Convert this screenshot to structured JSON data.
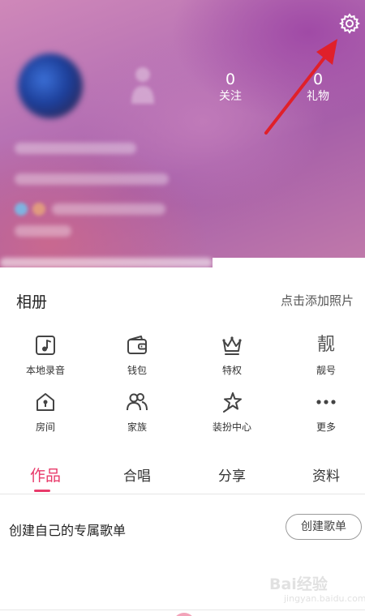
{
  "header": {
    "stats": [
      {
        "value": "0",
        "label": "关注"
      },
      {
        "value": "0",
        "label": "礼物"
      }
    ],
    "settings_icon": "gear-icon"
  },
  "album": {
    "title": "相册",
    "add_label": "点击添加照片"
  },
  "grid": {
    "items": [
      {
        "label": "本地录音",
        "icon": "music-note-icon"
      },
      {
        "label": "钱包",
        "icon": "wallet-icon"
      },
      {
        "label": "特权",
        "icon": "crown-icon"
      },
      {
        "label": "靓号",
        "icon": "liang-hao-glyph",
        "glyph": "靓"
      },
      {
        "label": "房间",
        "icon": "house-icon"
      },
      {
        "label": "家族",
        "icon": "family-icon"
      },
      {
        "label": "装扮中心",
        "icon": "star-icon"
      },
      {
        "label": "更多",
        "icon": "more-dots-icon"
      }
    ]
  },
  "tabs": [
    {
      "label": "作品",
      "active": true
    },
    {
      "label": "合唱",
      "active": false
    },
    {
      "label": "分享",
      "active": false
    },
    {
      "label": "资料",
      "active": false
    }
  ],
  "playlist": {
    "label": "创建自己的专属歌单",
    "button": "创建歌单"
  },
  "watermark": {
    "main": "Bai经验",
    "sub": "jingyan.baidu.com"
  },
  "colors": {
    "accent": "#e83a6a",
    "arrow": "#e0202a"
  }
}
